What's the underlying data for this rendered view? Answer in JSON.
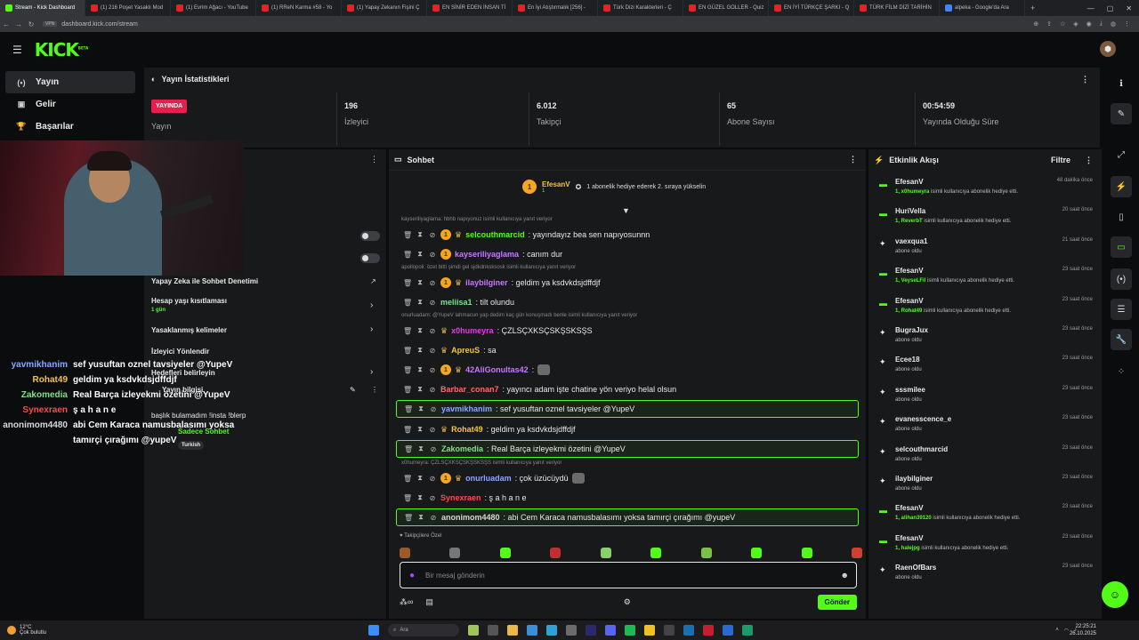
{
  "browser": {
    "tabs": [
      {
        "label": "Stream - Kick Dashboard",
        "color": "#53fc18",
        "active": true
      },
      {
        "label": "(1) 216 Poşet Yasaklı Mod",
        "color": "#e02424"
      },
      {
        "label": "(1) Evrim Ağacı - YouTube",
        "color": "#e02424"
      },
      {
        "label": "(1) RReN Karma #58 - Yo",
        "color": "#e02424"
      },
      {
        "label": "(1) Yapay Zekanın Fişini Ç",
        "color": "#e02424"
      },
      {
        "label": "EN SİNİR EDEN İNSAN Tİ",
        "color": "#e02424"
      },
      {
        "label": "En İyi Atıştırmalık [256] -",
        "color": "#e02424"
      },
      {
        "label": "Türk Dizi Karakterleri - Ç",
        "color": "#e02424"
      },
      {
        "label": "EN GÜZEL GOLLER - Quiz",
        "color": "#e02424"
      },
      {
        "label": "EN İYİ TÜRKÇE ŞARKI - Q",
        "color": "#e02424"
      },
      {
        "label": "TÜRK FİLM DİZİ TARİHİN",
        "color": "#e02424"
      },
      {
        "label": "alpeka - Google'da Ara",
        "color": "#4285f4"
      }
    ],
    "new_tab": "+",
    "url": "dashboard.kick.com/stream",
    "url_chip": "VPN"
  },
  "brand": {
    "logo": "KICK",
    "logo_sup": "BETA",
    "accent": "#53fc18"
  },
  "sidebar": {
    "items": [
      {
        "icon": "(•)",
        "label": "Yayın",
        "active": true
      },
      {
        "icon": "▣",
        "label": "Gelir"
      },
      {
        "icon": "🏆",
        "label": "Başarılar"
      }
    ]
  },
  "stats": {
    "title": "Yayın İstatistikleri",
    "live_badge": "YAYINDA",
    "live_label": "Yayın",
    "items": [
      {
        "value": "196",
        "label": "İzleyici"
      },
      {
        "value": "6.012",
        "label": "Takipçi"
      },
      {
        "value": "65",
        "label": "Abone Sayısı"
      },
      {
        "value": "00:54:59",
        "label": "Yayında Olduğu Süre"
      }
    ]
  },
  "left_panel": {
    "rows": [
      {
        "title": "Yapay Zeka ile Sohbet Denetimi",
        "sub": ""
      },
      {
        "title": "Hesap yaşı kısıtlaması",
        "sub": "1 gün"
      },
      {
        "title": "Yasaklanmış kelimeler",
        "sub": ""
      },
      {
        "title": "İzleyici Yönlendir",
        "sub": ""
      },
      {
        "title": "Hedefleri belirleyin",
        "sub": ""
      },
      {
        "title": "Yayın bilgisi",
        "sub": ""
      },
      {
        "title": "başlık bulamadım !insta !blerp",
        "sub": ""
      },
      {
        "title": "Sadece Sohbet",
        "sub": ""
      },
      {
        "title": "Turkish",
        "sub": ""
      }
    ]
  },
  "overlay_chat": [
    {
      "name": "yavmikhanim",
      "color": "#8aa8ff",
      "msg": "sef yusuftan oznel tavsiyeler @YupeV"
    },
    {
      "name": "Rohat49",
      "color": "#f5c542",
      "msg": "geldim ya ksdvkdsjdffdjf"
    },
    {
      "name": "Zakomedia",
      "color": "#7fe08a",
      "msg": "Real Barça izleyekmi özetini @YupeV"
    },
    {
      "name": "Synexraen",
      "color": "#ff4a4a",
      "msg": "ş a h a n e"
    },
    {
      "name": "anonimom4480",
      "color": "#d7d7d7",
      "msg": "abi Cem Karaca namusbalasımı yoksa"
    },
    {
      "name": "",
      "color": "#d7d7d7",
      "msg": "tamırçi çırağımı @yupeV"
    }
  ],
  "chat": {
    "title": "Sohbet",
    "pinned": {
      "name": "EfesanV",
      "sub": "1",
      "text": "1 abonelik hediye ederek 2. sıraya yükselin"
    },
    "messages": [
      {
        "reply": "kayseriliyaglama: hbhb napıyonuz isimli kullanıcıya yanıt veriyor"
      },
      {
        "name": "selcouthmarcid",
        "color": "#53fc18",
        "text": ": yayındayız bea sen napıyosunnn",
        "b1": true,
        "b2": true
      },
      {
        "name": "kayseriliyaglama",
        "color": "#c878ff",
        "text": ": canım dur",
        "b1": true
      },
      {
        "reply": "apollopoli: özet bitti şimdi gel sjdkdnksksosk isimli kullanıcıya yanıt veriyor"
      },
      {
        "name": "ilaybilginer",
        "color": "#c878ff",
        "text": ": geldim ya ksdvkdsjdffdjf",
        "b1": true,
        "b2": true
      },
      {
        "name": "meliisa1",
        "color": "#7fe08a",
        "text": ": tilt olundu"
      },
      {
        "reply": "onurluadam: @YupeV lahmacun yap dedim kaç gün konuşmadı benle isimli kullanıcıya yanıt veriyor"
      },
      {
        "name": "x0humeyra",
        "color": "#e040e0",
        "text": ": ÇZLSÇXKSÇSKŞSKSŞS",
        "b2": true
      },
      {
        "name": "ApreuS",
        "color": "#f5c542",
        "text": ": sa",
        "b2": true
      },
      {
        "name": "42AliGonultas42",
        "color": "#c878ff",
        "text": ":",
        "b1": true,
        "b2": true,
        "emote": true
      },
      {
        "name": "Barbar_conan7",
        "color": "#ff6a6a",
        "text": ": yayıncı adam işte chatine yön veriyo helal olsun"
      },
      {
        "name": "yavmikhanim",
        "color": "#8aa8ff",
        "text": ": sef yusuftan oznel tavsiyeler @YupeV",
        "hl": true
      },
      {
        "name": "Rohat49",
        "color": "#f5c542",
        "text": ": geldim ya ksdvkdsjdffdjf",
        "b2": true
      },
      {
        "name": "Zakomedia",
        "color": "#7fe08a",
        "text": ": Real Barça izleyekmi özetini @YupeV",
        "hl": true
      },
      {
        "reply": "x0humeyra: ÇZLSÇXKSÇSKŞSKSŞS isimli kullanıcıya yanıt veriyor"
      },
      {
        "name": "onurluadam",
        "color": "#8aa8ff",
        "text": ": çok üzücüydü",
        "b1": true,
        "b2": true,
        "emote": true
      },
      {
        "name": "Synexraen",
        "color": "#ff4a4a",
        "text": ": ş a h a n e"
      },
      {
        "name": "anonimom4480",
        "color": "#d7d7d7",
        "text": ": abi Cem Karaca namusbalasımı yoksa tamırçi çırağımı @yupeV",
        "hl": true
      }
    ],
    "followers_label": "Takipçilere Özel",
    "placeholder": "Bir mesaj gönderin",
    "send_label": "Gönder"
  },
  "activity": {
    "title": "Etkinlik Akışı",
    "filter_label": "Filtre",
    "events": [
      {
        "name": "EfesanV",
        "gift": true,
        "who": "1, x0humeyra",
        "desc": " isimli kullanıcıya abonelik hediye etti.",
        "time": "48 dakika önce"
      },
      {
        "name": "HuriVella",
        "gift": true,
        "who": "1, ReverbT",
        "desc": " isimli kullanıcıya abonelik hediye etti.",
        "time": "20 saat önce"
      },
      {
        "name": "vaexqua1",
        "desc": "abone oldu",
        "time": "21 saat önce"
      },
      {
        "name": "EfesanV",
        "gift": true,
        "who": "1, VeyseLFil",
        "desc": " isimli kullanıcıya abonelik hediye etti.",
        "time": "23 saat önce"
      },
      {
        "name": "EfesanV",
        "gift": true,
        "who": "1, Rohat49",
        "desc": " isimli kullanıcıya abonelik hediye etti.",
        "time": "23 saat önce"
      },
      {
        "name": "BugraJux",
        "desc": "abone oldu",
        "time": "23 saat önce"
      },
      {
        "name": "Ecee18",
        "desc": "abone oldu",
        "time": "23 saat önce"
      },
      {
        "name": "sssmilee",
        "desc": "abone oldu",
        "time": "23 saat önce"
      },
      {
        "name": "evanesscence_e",
        "desc": "abone oldu",
        "time": "23 saat önce"
      },
      {
        "name": "selcouthmarcid",
        "desc": "abone oldu",
        "time": "23 saat önce"
      },
      {
        "name": "ilaybilginer",
        "desc": "abone oldu",
        "time": "23 saat önce"
      },
      {
        "name": "EfesanV",
        "gift": true,
        "who": "1, alihan39120",
        "desc": " isimli kullanıcıya abonelik hediye etti.",
        "time": "23 saat önce"
      },
      {
        "name": "EfesanV",
        "gift": true,
        "who": "1, halejpg",
        "desc": " isimli kullanıcıya abonelik hediye etti.",
        "time": "23 saat önce"
      },
      {
        "name": "RaenOfBars",
        "desc": "abone oldu",
        "time": "23 saat önce"
      }
    ]
  },
  "taskbar": {
    "temp": "12°C",
    "weather": "Çok bulutlu",
    "search": "Ara",
    "time": "22:25:21",
    "date": "26.10.2025"
  }
}
